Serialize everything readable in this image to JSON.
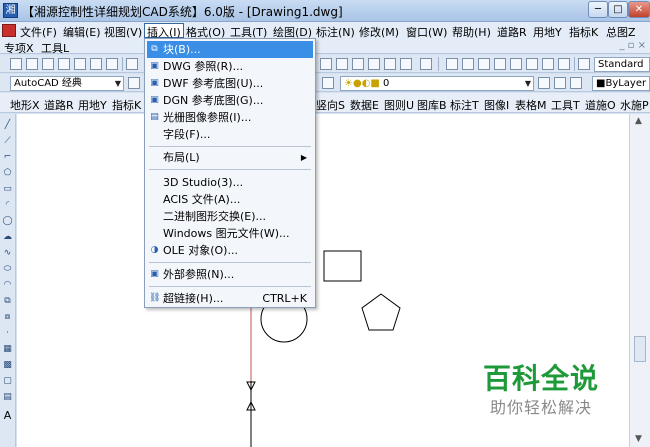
{
  "window": {
    "title": "【湘源控制性详细规划CAD系统】6.0版 - [Drawing1.dwg]",
    "min": "─",
    "max": "□",
    "close": "✕"
  },
  "menubar": {
    "items": [
      "文件(F)",
      "编辑(E)",
      "视图(V)",
      "插入(I)",
      "格式(O)",
      "工具(T)",
      "绘图(D)",
      "标注(N)",
      "修改(M)",
      "窗口(W)",
      "帮助(H)",
      "道路R",
      "用地Y",
      "指标K",
      "总图Z"
    ],
    "row2": [
      "专项X",
      "工具L"
    ],
    "mdi": "_ ▫ ×"
  },
  "toolbar": {
    "text_style": "Standard",
    "font_combo": "AutoCAD 经典",
    "layer_combo": "0",
    "linetype": "ByLayer"
  },
  "toolbar3": {
    "items": [
      "地形X",
      "道路R",
      "用地Y",
      "指标K",
      "竖向S",
      "数据E",
      "图则U",
      "图库B",
      "标注T",
      "图像I",
      "表格M",
      "工具T",
      "道施O",
      "水施P"
    ]
  },
  "insert_menu": {
    "items": [
      {
        "label": "块(B)...",
        "icon": "block-icon",
        "highlight": true
      },
      {
        "label": "DWG 参照(R)...",
        "icon": "dwg-ref-icon"
      },
      {
        "label": "DWF 参考底图(U)...",
        "icon": "dwf-icon"
      },
      {
        "label": "DGN 参考底图(G)...",
        "icon": "dgn-icon"
      },
      {
        "label": "光栅图像参照(I)...",
        "icon": "raster-image-icon"
      },
      {
        "label": "字段(F)...",
        "icon": "field-icon"
      },
      {
        "label": "布局(L)",
        "submenu": true
      },
      {
        "label": "3D Studio(3)..."
      },
      {
        "label": "ACIS 文件(A)..."
      },
      {
        "label": "二进制图形交换(E)..."
      },
      {
        "label": "Windows 图元文件(W)..."
      },
      {
        "label": "OLE 对象(O)...",
        "icon": "ole-icon"
      },
      {
        "label": "外部参照(N)...",
        "icon": "xref-icon"
      },
      {
        "label": "超链接(H)...",
        "icon": "hyperlink-icon",
        "accel": "CTRL+K"
      }
    ]
  },
  "watermark": {
    "title": "百科全说",
    "subtitle": "助你轻松解决"
  },
  "colors": {
    "highlight": "#3a8ee6",
    "watermark": "#1f9a3a"
  }
}
